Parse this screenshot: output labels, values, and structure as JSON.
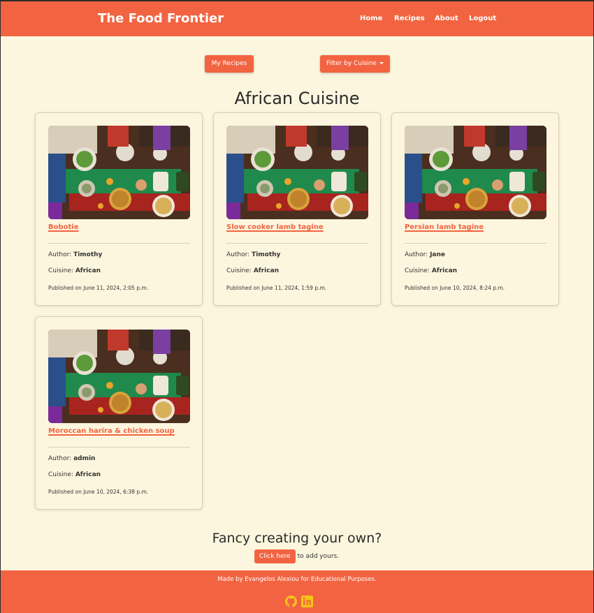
{
  "header": {
    "brand": "The Food Frontier",
    "nav": [
      "Home",
      "Recipes",
      "About",
      "Logout"
    ]
  },
  "toolbar": {
    "my_recipes_label": "My Recipes",
    "filter_label": "Filter by Cuisine"
  },
  "main": {
    "title": "African Cuisine",
    "author_prefix": "Author:",
    "cuisine_prefix": "Cuisine:",
    "cards": [
      {
        "title": "Bobotie",
        "author": "Timothy",
        "cuisine": "African",
        "published": "Published on June 11, 2024, 2:05 p.m."
      },
      {
        "title": "Slow cooker lamb tagine",
        "author": "Timothy",
        "cuisine": "African",
        "published": "Published on June 11, 2024, 1:59 p.m."
      },
      {
        "title": "Persian lamb tagine",
        "author": "Jane",
        "cuisine": "African",
        "published": "Published on June 10, 2024, 8:24 p.m."
      },
      {
        "title": "Moroccan harira & chicken soup",
        "author": "admin",
        "cuisine": "African",
        "published": "Published on June 10, 2024, 6:38 p.m."
      }
    ]
  },
  "cta": {
    "title": "Fancy creating your own?",
    "button_label": "Click here",
    "suffix": "to add yours."
  },
  "footer": {
    "text": "Made by Evangelos Alexiou for Educational Purposes.",
    "icons": [
      "github-icon",
      "linkedin-icon"
    ]
  },
  "colors": {
    "accent": "#f26441",
    "background": "#fdf6de",
    "icon_yellow": "#f5c518"
  }
}
